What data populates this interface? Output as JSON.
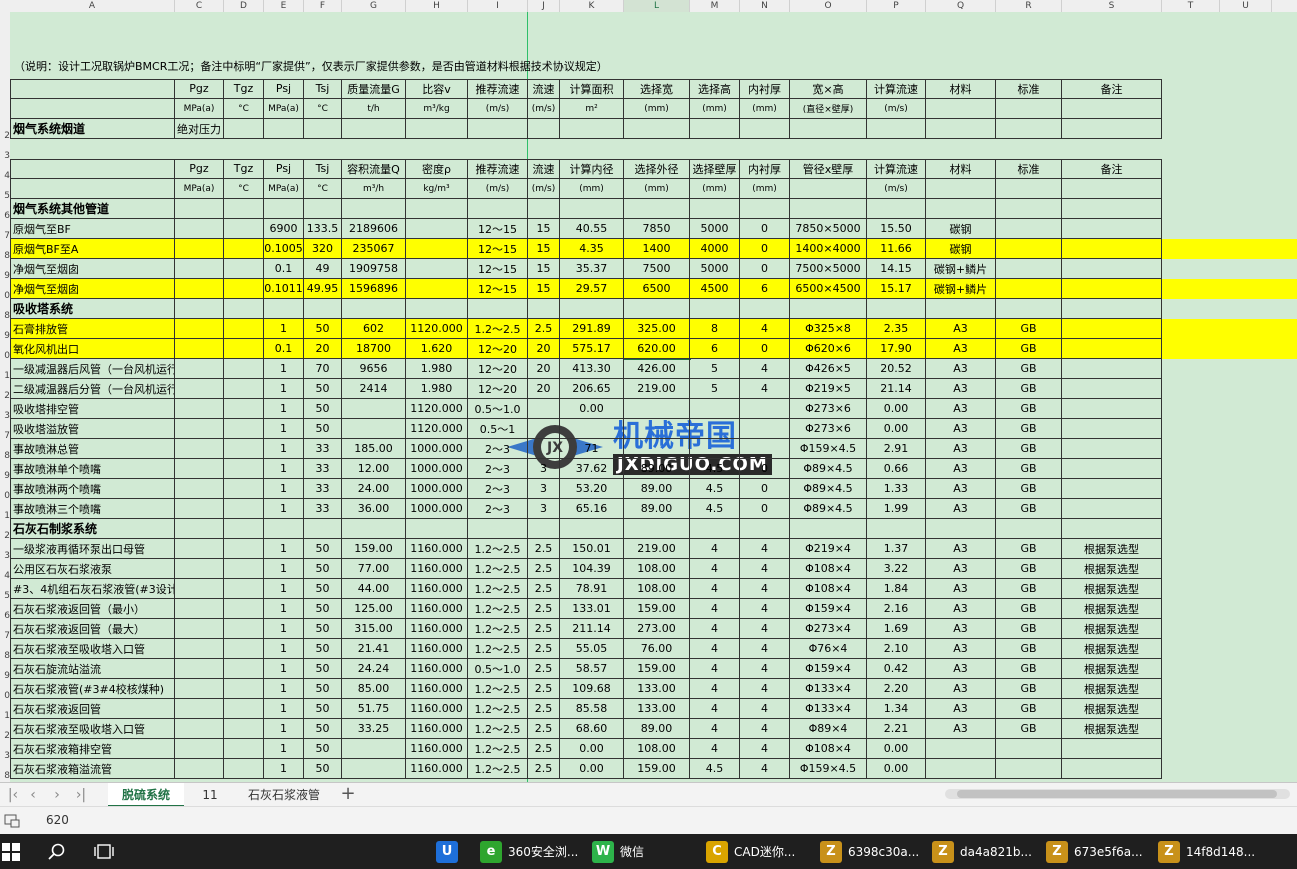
{
  "columns": [
    "A",
    "C",
    "D",
    "E",
    "F",
    "G",
    "H",
    "I",
    "J",
    "K",
    "L",
    "M",
    "N",
    "O",
    "P",
    "Q",
    "R",
    "S",
    "T",
    "U"
  ],
  "row_numbers": [
    "",
    "",
    "",
    "",
    "",
    "",
    "2",
    "3",
    "4",
    "5",
    "6",
    "7",
    "8",
    "9",
    "0",
    "8",
    "9",
    "0",
    "1",
    "2",
    "3",
    "7",
    "8",
    "9",
    "0",
    "1",
    "2",
    "3",
    "4",
    "5",
    "6",
    "7",
    "8",
    "9",
    "0",
    "1",
    "2",
    "3",
    "8"
  ],
  "note": "（说明：设计工况取锅炉BMCR工况；备注中标明“厂家提供”，仅表示厂家提供参数，是否由管道材料根据技术协议规定）",
  "table1": {
    "header1": [
      "",
      "Pgz",
      "Tgz",
      "Psj",
      "Tsj",
      "质量流量G",
      "比容v",
      "推荐流速",
      "流速",
      "计算面积",
      "选择宽",
      "选择高",
      "内衬厚",
      "宽×高",
      "计算流速",
      "材料",
      "标准",
      "备注"
    ],
    "header2": [
      "",
      "MPa(a)",
      "°C",
      "MPa(a)",
      "°C",
      "t/h",
      "m³/kg",
      "(m/s)",
      "(m/s)",
      "m²",
      "(mm)",
      "(mm)",
      "(mm)",
      "(直径×壁厚)",
      "(m/s)",
      "",
      "",
      ""
    ],
    "section": [
      "烟气系统烟道",
      "绝对压力"
    ]
  },
  "table2": {
    "header1": [
      "",
      "Pgz",
      "Tgz",
      "Psj",
      "Tsj",
      "容积流量Q",
      "密度ρ",
      "推荐流速",
      "流速",
      "计算内径",
      "选择外径",
      "选择壁厚",
      "内衬厚",
      "管径x壁厚",
      "计算流速",
      "材料",
      "标准",
      "备注"
    ],
    "header2": [
      "",
      "MPa(a)",
      "°C",
      "MPa(a)",
      "°C",
      "m³/h",
      "kg/m³",
      "(m/s)",
      "(m/s)",
      "(mm)",
      "(mm)",
      "(mm)",
      "(mm)",
      "",
      "(m/s)",
      "",
      "",
      ""
    ]
  },
  "rows": [
    {
      "type": "section",
      "label": "烟气系统其他管道"
    },
    {
      "type": "data",
      "yellow": false,
      "cells": [
        "原烟气至BF",
        "",
        "",
        "6900",
        "133.5",
        "2189606",
        "",
        "12～15",
        "15",
        "40.55",
        "7850",
        "5000",
        "0",
        "7850×5000",
        "15.50",
        "碳钢",
        "",
        ""
      ]
    },
    {
      "type": "data",
      "yellow": true,
      "cells": [
        "原烟气BF至A",
        "",
        "",
        "0.1005",
        "320",
        "235067",
        "",
        "12～15",
        "15",
        "4.35",
        "1400",
        "4000",
        "0",
        "1400×4000",
        "11.66",
        "碳钢",
        "",
        ""
      ]
    },
    {
      "type": "data",
      "yellow": false,
      "cells": [
        "净烟气至烟囱",
        "",
        "",
        "0.1",
        "49",
        "1909758",
        "",
        "12～15",
        "15",
        "35.37",
        "7500",
        "5000",
        "0",
        "7500×5000",
        "14.15",
        "碳钢+鳞片",
        "",
        ""
      ]
    },
    {
      "type": "data",
      "yellow": true,
      "cells": [
        "净烟气至烟囱",
        "",
        "",
        "0.1011",
        "49.95",
        "1596896",
        "",
        "12～15",
        "15",
        "29.57",
        "6500",
        "4500",
        "6",
        "6500×4500",
        "15.17",
        "碳钢+鳞片",
        "",
        ""
      ]
    },
    {
      "type": "section",
      "label": "吸收塔系统"
    },
    {
      "type": "data",
      "yellow": true,
      "cells": [
        "石膏排放管",
        "",
        "",
        "1",
        "50",
        "602",
        "1120.000",
        "1.2～2.5",
        "2.5",
        "291.89",
        "325.00",
        "8",
        "4",
        "Φ325×8",
        "2.35",
        "A3",
        "GB",
        ""
      ]
    },
    {
      "type": "data",
      "yellow": true,
      "cells": [
        "氧化风机出口",
        "",
        "",
        "0.1",
        "20",
        "18700",
        "1.620",
        "12～20",
        "20",
        "575.17",
        "620.00",
        "6",
        "0",
        "Φ620×6",
        "17.90",
        "A3",
        "GB",
        ""
      ]
    },
    {
      "type": "data",
      "yellow": false,
      "cells": [
        "一级减温器后风管（一台风机运行）",
        "",
        "",
        "1",
        "70",
        "9656",
        "1.980",
        "12～20",
        "20",
        "413.30",
        "426.00",
        "5",
        "4",
        "Φ426×5",
        "20.52",
        "A3",
        "GB",
        ""
      ]
    },
    {
      "type": "data",
      "yellow": false,
      "cells": [
        "二级减温器后分管（一台风机运行）",
        "",
        "",
        "1",
        "50",
        "2414",
        "1.980",
        "12～20",
        "20",
        "206.65",
        "219.00",
        "5",
        "4",
        "Φ219×5",
        "21.14",
        "A3",
        "GB",
        ""
      ]
    },
    {
      "type": "data",
      "yellow": false,
      "cells": [
        "吸收塔排空管",
        "",
        "",
        "1",
        "50",
        "",
        "1120.000",
        "0.5～1.0",
        "",
        "0.00",
        "",
        "",
        "",
        "Φ273×6",
        "0.00",
        "A3",
        "GB",
        ""
      ]
    },
    {
      "type": "data",
      "yellow": false,
      "cells": [
        "吸收塔溢放管",
        "",
        "",
        "1",
        "50",
        "",
        "1120.000",
        "0.5～1",
        "",
        "",
        "",
        "",
        "",
        "Φ273×6",
        "0.00",
        "A3",
        "GB",
        ""
      ]
    },
    {
      "type": "data",
      "yellow": false,
      "cells": [
        "事故喷淋总管",
        "",
        "",
        "1",
        "33",
        "185.00",
        "1000.000",
        "2～3",
        "",
        "71",
        "",
        "",
        "",
        "Φ159×4.5",
        "2.91",
        "A3",
        "GB",
        ""
      ]
    },
    {
      "type": "data",
      "yellow": false,
      "cells": [
        "事故喷淋单个喷嘴",
        "",
        "",
        "1",
        "33",
        "12.00",
        "1000.000",
        "2～3",
        "3",
        "37.62",
        "89.00",
        "4.5",
        "0",
        "Φ89×4.5",
        "0.66",
        "A3",
        "GB",
        ""
      ]
    },
    {
      "type": "data",
      "yellow": false,
      "cells": [
        "事故喷淋两个喷嘴",
        "",
        "",
        "1",
        "33",
        "24.00",
        "1000.000",
        "2～3",
        "3",
        "53.20",
        "89.00",
        "4.5",
        "0",
        "Φ89×4.5",
        "1.33",
        "A3",
        "GB",
        ""
      ]
    },
    {
      "type": "data",
      "yellow": false,
      "cells": [
        "事故喷淋三个喷嘴",
        "",
        "",
        "1",
        "33",
        "36.00",
        "1000.000",
        "2～3",
        "3",
        "65.16",
        "89.00",
        "4.5",
        "0",
        "Φ89×4.5",
        "1.99",
        "A3",
        "GB",
        ""
      ]
    },
    {
      "type": "section",
      "label": "石灰石制浆系统"
    },
    {
      "type": "data",
      "yellow": false,
      "cells": [
        "一级浆液再循环泵出口母管",
        "",
        "",
        "1",
        "50",
        "159.00",
        "1160.000",
        "1.2～2.5",
        "2.5",
        "150.01",
        "219.00",
        "4",
        "4",
        "Φ219×4",
        "1.37",
        "A3",
        "GB",
        "根据泵选型"
      ]
    },
    {
      "type": "data",
      "yellow": false,
      "cells": [
        "公用区石灰石浆液泵",
        "",
        "",
        "1",
        "50",
        "77.00",
        "1160.000",
        "1.2～2.5",
        "2.5",
        "104.39",
        "108.00",
        "4",
        "4",
        "Φ108×4",
        "3.22",
        "A3",
        "GB",
        "根据泵选型"
      ]
    },
    {
      "type": "data",
      "yellow": false,
      "cells": [
        "#3、4机组石灰石浆液管(#3设计煤种)",
        "",
        "",
        "1",
        "50",
        "44.00",
        "1160.000",
        "1.2～2.5",
        "2.5",
        "78.91",
        "108.00",
        "4",
        "4",
        "Φ108×4",
        "1.84",
        "A3",
        "GB",
        "根据泵选型"
      ]
    },
    {
      "type": "data",
      "yellow": false,
      "cells": [
        "石灰石浆液返回管（最小）",
        "",
        "",
        "1",
        "50",
        "125.00",
        "1160.000",
        "1.2～2.5",
        "2.5",
        "133.01",
        "159.00",
        "4",
        "4",
        "Φ159×4",
        "2.16",
        "A3",
        "GB",
        "根据泵选型"
      ]
    },
    {
      "type": "data",
      "yellow": false,
      "cells": [
        "石灰石浆液返回管（最大）",
        "",
        "",
        "1",
        "50",
        "315.00",
        "1160.000",
        "1.2～2.5",
        "2.5",
        "211.14",
        "273.00",
        "4",
        "4",
        "Φ273×4",
        "1.69",
        "A3",
        "GB",
        "根据泵选型"
      ]
    },
    {
      "type": "data",
      "yellow": false,
      "cells": [
        "石灰石浆液至吸收塔入口管",
        "",
        "",
        "1",
        "50",
        "21.41",
        "1160.000",
        "1.2～2.5",
        "2.5",
        "55.05",
        "76.00",
        "4",
        "4",
        "Φ76×4",
        "2.10",
        "A3",
        "GB",
        "根据泵选型"
      ]
    },
    {
      "type": "data",
      "yellow": false,
      "cells": [
        "石灰石旋流站溢流",
        "",
        "",
        "1",
        "50",
        "24.24",
        "1160.000",
        "0.5～1.0",
        "2.5",
        "58.57",
        "159.00",
        "4",
        "4",
        "Φ159×4",
        "0.42",
        "A3",
        "GB",
        "根据泵选型"
      ]
    },
    {
      "type": "data",
      "yellow": false,
      "cells": [
        "石灰石浆液管(#3#4校核煤种)",
        "",
        "",
        "1",
        "50",
        "85.00",
        "1160.000",
        "1.2～2.5",
        "2.5",
        "109.68",
        "133.00",
        "4",
        "4",
        "Φ133×4",
        "2.20",
        "A3",
        "GB",
        "根据泵选型"
      ]
    },
    {
      "type": "data",
      "yellow": false,
      "cells": [
        "石灰石浆液返回管",
        "",
        "",
        "1",
        "50",
        "51.75",
        "1160.000",
        "1.2～2.5",
        "2.5",
        "85.58",
        "133.00",
        "4",
        "4",
        "Φ133×4",
        "1.34",
        "A3",
        "GB",
        "根据泵选型"
      ]
    },
    {
      "type": "data",
      "yellow": false,
      "cells": [
        "石灰石浆液至吸收塔入口管",
        "",
        "",
        "1",
        "50",
        "33.25",
        "1160.000",
        "1.2～2.5",
        "2.5",
        "68.60",
        "89.00",
        "4",
        "4",
        "Φ89×4",
        "2.21",
        "A3",
        "GB",
        "根据泵选型"
      ]
    },
    {
      "type": "data",
      "yellow": false,
      "cells": [
        "石灰石浆液箱排空管",
        "",
        "",
        "1",
        "50",
        "",
        "1160.000",
        "1.2～2.5",
        "2.5",
        "0.00",
        "108.00",
        "4",
        "4",
        "Φ108×4",
        "0.00",
        "",
        "",
        ""
      ]
    },
    {
      "type": "data",
      "yellow": false,
      "cells": [
        "石灰石浆液箱溢流管",
        "",
        "",
        "1",
        "50",
        "",
        "1160.000",
        "1.2～2.5",
        "2.5",
        "0.00",
        "159.00",
        "4.5",
        "4",
        "Φ159×4.5",
        "0.00",
        "",
        "",
        ""
      ]
    }
  ],
  "watermark": {
    "cn": "机械帝国",
    "en": "JXDIGUO.COM",
    "logo": "JX"
  },
  "tabs": [
    "脱硫系统",
    "11",
    "石灰石浆液管"
  ],
  "active_tab": 0,
  "status": {
    "value": "620"
  },
  "taskbar": [
    {
      "label": "",
      "icon": "tencent-app-icon",
      "color": "#1e6fd9",
      "glyph": "U"
    },
    {
      "label": "360安全浏...",
      "icon": "browser-360-icon",
      "color": "#2ea52e",
      "glyph": "e"
    },
    {
      "label": "微信",
      "icon": "wechat-icon",
      "color": "#2db34a",
      "glyph": "W"
    },
    {
      "label": "CAD迷你...",
      "icon": "cad-icon",
      "color": "#d9a400",
      "glyph": "C"
    },
    {
      "label": "6398c30a...",
      "icon": "archive-icon",
      "color": "#c8911a",
      "glyph": "Z"
    },
    {
      "label": "da4a821b...",
      "icon": "archive-icon",
      "color": "#c8911a",
      "glyph": "Z"
    },
    {
      "label": "673e5f6a...",
      "icon": "archive-icon",
      "color": "#c8911a",
      "glyph": "Z"
    },
    {
      "label": "14f8d148...",
      "icon": "archive-icon",
      "color": "#c8911a",
      "glyph": "Z"
    }
  ]
}
